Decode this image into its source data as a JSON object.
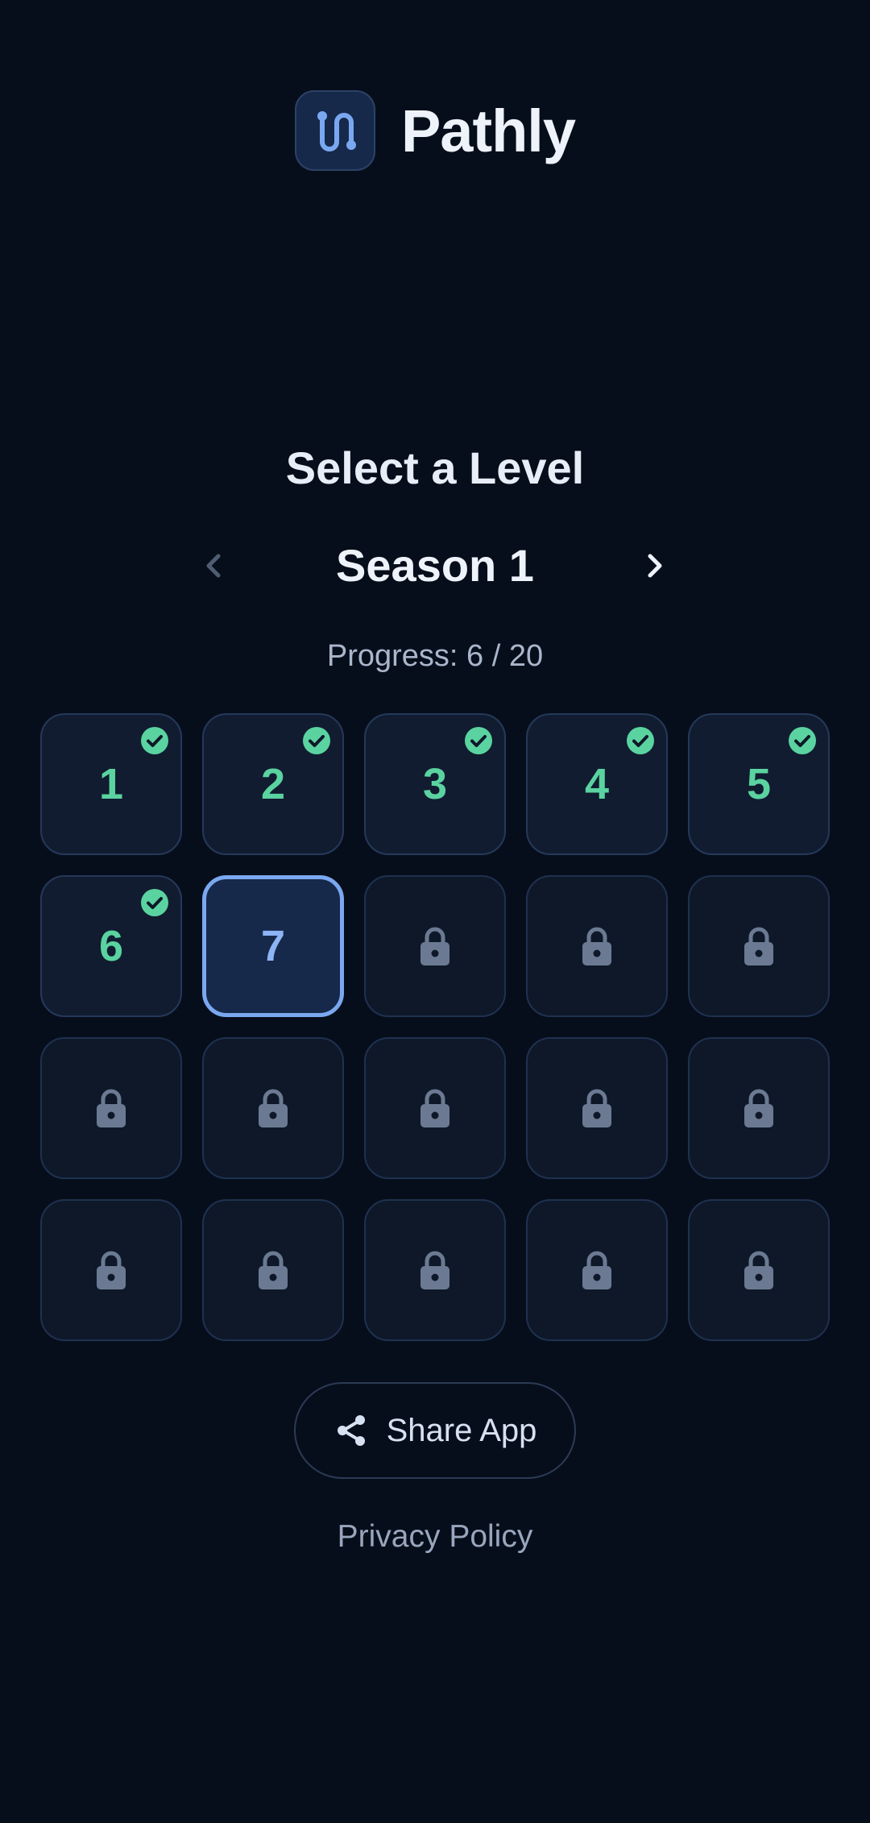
{
  "app": {
    "name": "Pathly",
    "logo_icon": "path-route-icon"
  },
  "screen": {
    "title": "Select a Level",
    "season": "Season 1",
    "prev_icon": "chevron-left-icon",
    "next_icon": "chevron-right-icon",
    "progress_text": "Progress: 6 / 20"
  },
  "progress": {
    "completed": 6,
    "total": 20
  },
  "levels": [
    {
      "label": "1",
      "state": "completed"
    },
    {
      "label": "2",
      "state": "completed"
    },
    {
      "label": "3",
      "state": "completed"
    },
    {
      "label": "4",
      "state": "completed"
    },
    {
      "label": "5",
      "state": "completed"
    },
    {
      "label": "6",
      "state": "completed"
    },
    {
      "label": "7",
      "state": "current"
    },
    {
      "label": "",
      "state": "locked"
    },
    {
      "label": "",
      "state": "locked"
    },
    {
      "label": "",
      "state": "locked"
    },
    {
      "label": "",
      "state": "locked"
    },
    {
      "label": "",
      "state": "locked"
    },
    {
      "label": "",
      "state": "locked"
    },
    {
      "label": "",
      "state": "locked"
    },
    {
      "label": "",
      "state": "locked"
    },
    {
      "label": "",
      "state": "locked"
    },
    {
      "label": "",
      "state": "locked"
    },
    {
      "label": "",
      "state": "locked"
    },
    {
      "label": "",
      "state": "locked"
    },
    {
      "label": "",
      "state": "locked"
    }
  ],
  "footer": {
    "share_label": "Share App",
    "share_icon": "share-icon",
    "privacy_label": "Privacy Policy"
  },
  "colors": {
    "background": "#070e1b",
    "completed": "#5ad3a0",
    "current_accent": "#7aa8f0",
    "locked_icon": "#6b7a92"
  }
}
